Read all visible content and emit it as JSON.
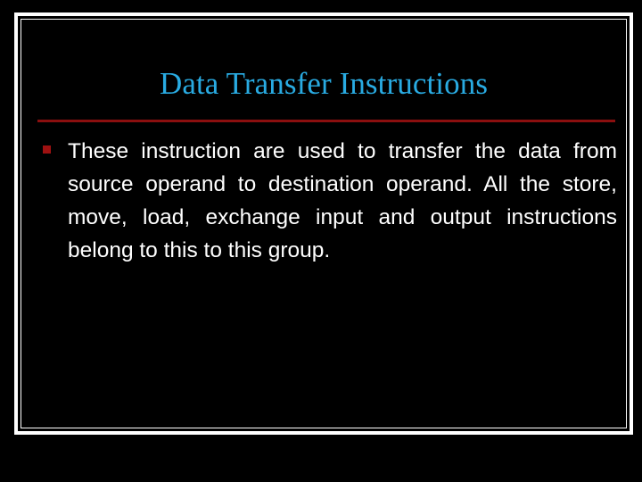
{
  "slide": {
    "background_color": "#000000",
    "frame": {
      "color": "#ffffff",
      "style": "double-line-border"
    },
    "title": {
      "text": "Data Transfer Instructions",
      "color": "#29abe2"
    },
    "divider": {
      "color": "#8b0f0f"
    },
    "body": {
      "bullets": [
        {
          "marker_icon": "square-bullet-icon",
          "marker_color": "#9e1111",
          "text": "These instruction are used to transfer the data from source operand to destination operand. All the store, move, load, exchange input and output instructions belong to this to this group.",
          "text_color": "#ffffff"
        }
      ]
    }
  }
}
